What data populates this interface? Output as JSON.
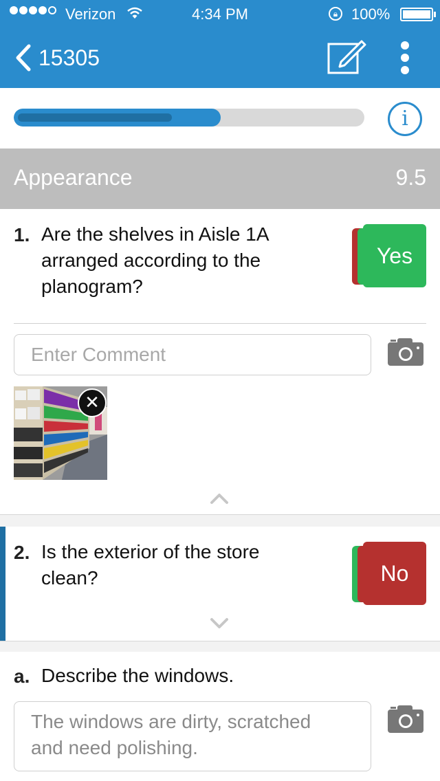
{
  "status_bar": {
    "carrier": "Verizon",
    "time": "4:34 PM",
    "battery": "100%",
    "signal_bars_filled": 4,
    "signal_bars_total": 5
  },
  "nav": {
    "title": "15305",
    "icons": [
      "chevron-left-icon",
      "edit-icon",
      "more-vertical-icon"
    ]
  },
  "progress": {
    "fraction": 0.59,
    "info_label": "i"
  },
  "section": {
    "title": "Appearance",
    "score": "9.5"
  },
  "questions": [
    {
      "number": "1.",
      "text_lines": [
        "Are the shelves in Aisle 1A",
        "arranged according to the",
        "planogram?"
      ],
      "answer": "Yes",
      "comment_placeholder": "Enter Comment",
      "has_photo": true,
      "photo_remove_glyph": "✕"
    },
    {
      "number": "2.",
      "text_lines": [
        "Is the exterior of the store",
        "clean?"
      ],
      "answer": "No"
    }
  ],
  "subquestion": {
    "label": "a.",
    "text": "Describe the windows.",
    "comment_lines": [
      "The windows are dirty, scratched",
      "and need polishing."
    ]
  },
  "colors": {
    "brand_blue": "#2a8ccd",
    "dark_blue": "#1f6fa3",
    "yes_green": "#2db85b",
    "no_red": "#b5312f",
    "section_gray": "#bdbdbd"
  }
}
